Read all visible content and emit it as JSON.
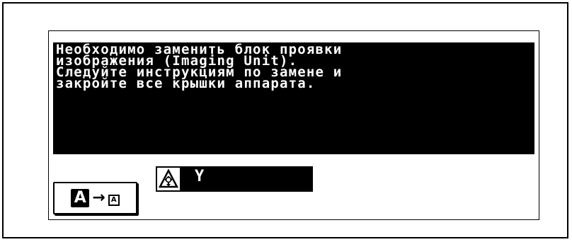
{
  "message": {
    "lines": [
      "Необходимо заменить блок проявки",
      "изображения (Imaging Unit).",
      "Следуйте инструкциям по замене и",
      "закройте все крышки аппарата."
    ]
  },
  "mode_button": {
    "large_char": "A",
    "arrow": "→",
    "small_char": "A"
  },
  "toner_indicator": {
    "icon": "imaging-unit-warning-icon",
    "color_label": "Y"
  }
}
